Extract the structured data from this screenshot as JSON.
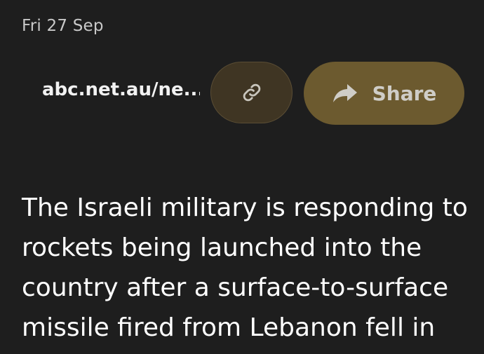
{
  "header": {
    "date": "Fri 27 Sep"
  },
  "toolbar": {
    "url": "abc.net.au/ne...",
    "link_icon": "link-icon",
    "share_icon": "share-arrow-icon",
    "share_label": "Share"
  },
  "article": {
    "text": "The Israeli military is responding to rockets being launched into the country after a surface-to-surface missile fired from Lebanon fell in"
  },
  "colors": {
    "background": "#1e1e1e",
    "link_button": "#3f3523",
    "share_button": "#6c5a2f",
    "text": "#ffffff"
  }
}
